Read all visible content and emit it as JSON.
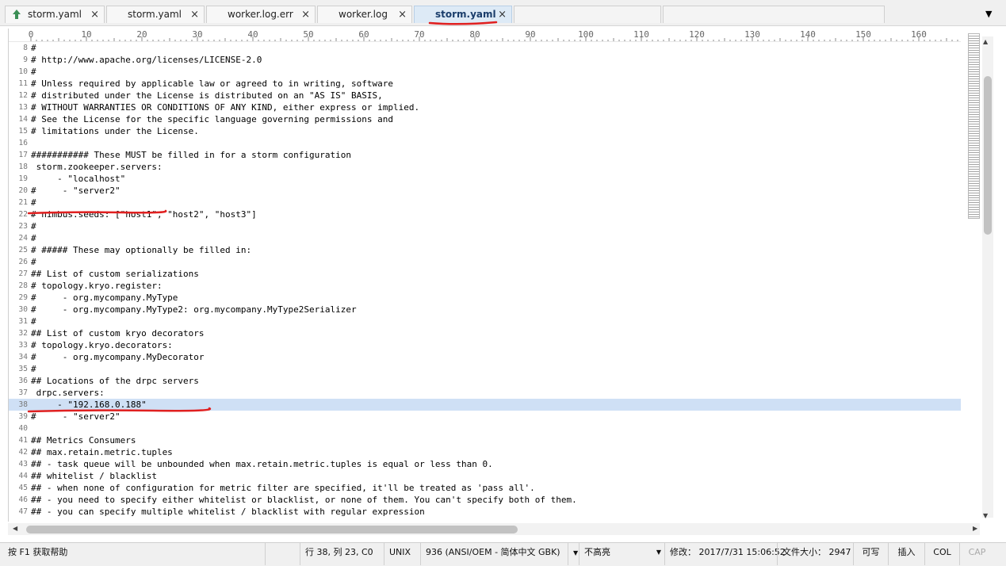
{
  "tabs": [
    {
      "label": "storm.yaml",
      "active": false,
      "icon": "up-arrow-icon"
    },
    {
      "label": "storm.yaml",
      "active": false
    },
    {
      "label": "worker.log.err",
      "active": false
    },
    {
      "label": "worker.log",
      "active": false
    },
    {
      "label": "storm.yaml",
      "active": true
    }
  ],
  "tab_close": "×",
  "tab_dropdown": "▼",
  "ruler": [
    "0",
    "10",
    "20",
    "30",
    "40",
    "50",
    "60",
    "70",
    "80",
    "90",
    "100",
    "110",
    "120",
    "130",
    "140",
    "150",
    "160"
  ],
  "lines": [
    {
      "n": "8",
      "t": "#"
    },
    {
      "n": "9",
      "t": "# http://www.apache.org/licenses/LICENSE-2.0"
    },
    {
      "n": "10",
      "t": "#"
    },
    {
      "n": "11",
      "t": "# Unless required by applicable law or agreed to in writing, software"
    },
    {
      "n": "12",
      "t": "# distributed under the License is distributed on an \"AS IS\" BASIS,"
    },
    {
      "n": "13",
      "t": "# WITHOUT WARRANTIES OR CONDITIONS OF ANY KIND, either express or implied."
    },
    {
      "n": "14",
      "t": "# See the License for the specific language governing permissions and"
    },
    {
      "n": "15",
      "t": "# limitations under the License."
    },
    {
      "n": "16",
      "t": ""
    },
    {
      "n": "17",
      "t": "########### These MUST be filled in for a storm configuration"
    },
    {
      "n": "18",
      "t": " storm.zookeeper.servers:"
    },
    {
      "n": "19",
      "t": "     - \"localhost\""
    },
    {
      "n": "20",
      "t": "#     - \"server2\""
    },
    {
      "n": "21",
      "t": "#"
    },
    {
      "n": "22",
      "t": "# nimbus.seeds: [\"host1\", \"host2\", \"host3\"]"
    },
    {
      "n": "23",
      "t": "#"
    },
    {
      "n": "24",
      "t": "#"
    },
    {
      "n": "25",
      "t": "# ##### These may optionally be filled in:"
    },
    {
      "n": "26",
      "t": "#"
    },
    {
      "n": "27",
      "t": "## List of custom serializations"
    },
    {
      "n": "28",
      "t": "# topology.kryo.register:"
    },
    {
      "n": "29",
      "t": "#     - org.mycompany.MyType"
    },
    {
      "n": "30",
      "t": "#     - org.mycompany.MyType2: org.mycompany.MyType2Serializer"
    },
    {
      "n": "31",
      "t": "#"
    },
    {
      "n": "32",
      "t": "## List of custom kryo decorators"
    },
    {
      "n": "33",
      "t": "# topology.kryo.decorators:"
    },
    {
      "n": "34",
      "t": "#     - org.mycompany.MyDecorator"
    },
    {
      "n": "35",
      "t": "#"
    },
    {
      "n": "36",
      "t": "## Locations of the drpc servers"
    },
    {
      "n": "37",
      "t": " drpc.servers:"
    },
    {
      "n": "38",
      "t": "     - \"192.168.0.188\"",
      "hl": true
    },
    {
      "n": "39",
      "t": "#     - \"server2\""
    },
    {
      "n": "40",
      "t": ""
    },
    {
      "n": "41",
      "t": "## Metrics Consumers"
    },
    {
      "n": "42",
      "t": "## max.retain.metric.tuples"
    },
    {
      "n": "43",
      "t": "## - task queue will be unbounded when max.retain.metric.tuples is equal or less than 0."
    },
    {
      "n": "44",
      "t": "## whitelist / blacklist"
    },
    {
      "n": "45",
      "t": "## - when none of configuration for metric filter are specified, it'll be treated as 'pass all'."
    },
    {
      "n": "46",
      "t": "## - you need to specify either whitelist or blacklist, or none of them. You can't specify both of them."
    },
    {
      "n": "47",
      "t": "## - you can specify multiple whitelist / blacklist with regular expression"
    }
  ],
  "status": {
    "help": "按 F1 获取帮助",
    "position": "行 38, 列 23, C0",
    "line_ending": "UNIX",
    "encoding": "936  (ANSI/OEM - 简体中文 GBK)",
    "highlight": "不高亮",
    "modified": "修改： 2017/7/31 15:06:52",
    "filesize": "文件大小： 2947",
    "writable": "可写",
    "insert": "插入",
    "col": "COL",
    "cap": "CAP"
  },
  "colors": {
    "annotation": "#e02020",
    "highlight": "#cfe0f5",
    "active_tab": "#ddeaf6"
  }
}
